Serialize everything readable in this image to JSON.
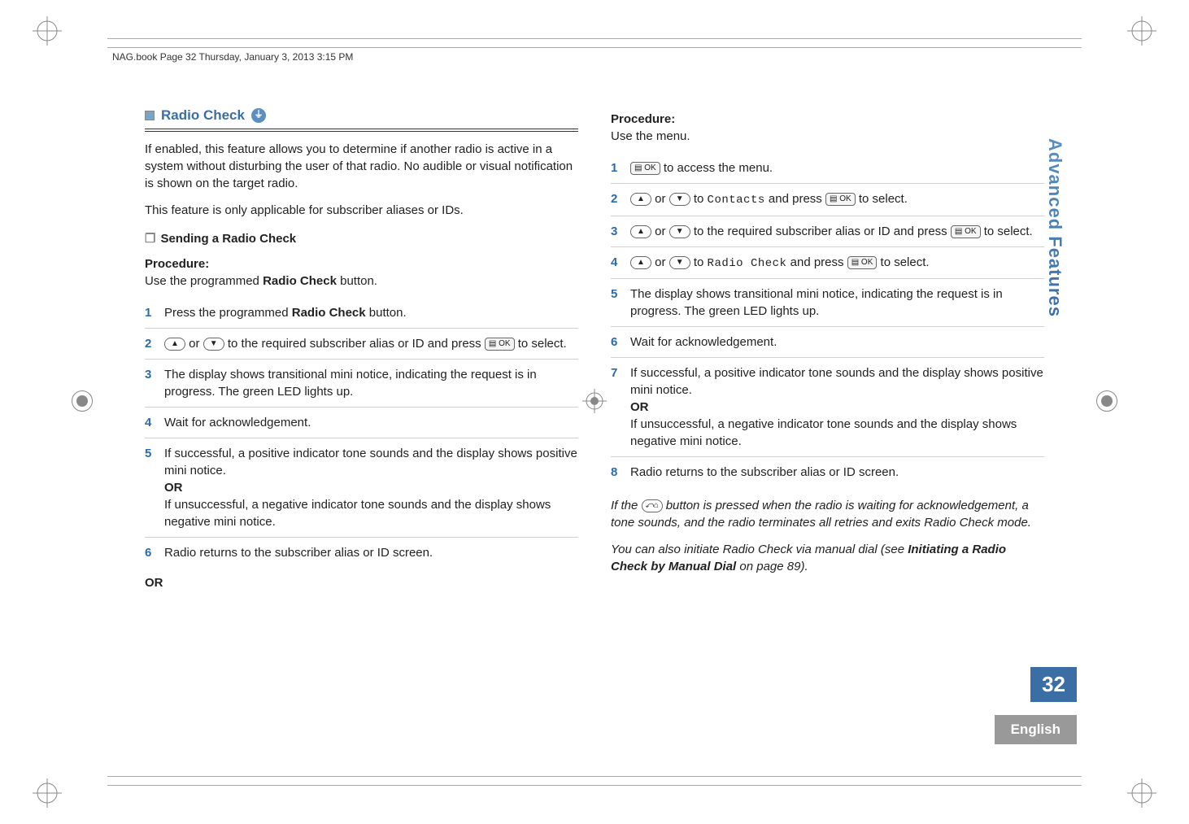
{
  "header": "NAG.book  Page 32  Thursday, January 3, 2013  3:15 PM",
  "side_tab": "Advanced Features",
  "page_number": "32",
  "language": "English",
  "left": {
    "section_title": "Radio Check",
    "para1": "If enabled, this feature allows you to determine if another radio is active in a system without disturbing the user of that radio. No audible or visual notification is shown on the target radio.",
    "para2": "This feature is only applicable for subscriber aliases or IDs.",
    "sub_title": "Sending a Radio Check",
    "proc_label": "Procedure:",
    "proc_sub": "Use the programmed Radio Check button.",
    "steps": [
      "Press the programmed Radio Check button.",
      "__UPDOWN__ to the required subscriber alias or ID and press __OK__ to select.",
      "The display shows transitional mini notice, indicating the request is in progress. The green LED lights up.",
      "Wait for acknowledgement.",
      "If successful, a positive indicator tone sounds and the display shows positive mini notice.\nOR\nIf unsuccessful, a negative indicator tone sounds and the display shows negative mini notice.",
      "Radio returns to the subscriber alias or ID screen."
    ],
    "or_end": "OR"
  },
  "right": {
    "proc_label": "Procedure:",
    "proc_sub": "Use the menu.",
    "steps": {
      "s1": " to access the menu.",
      "s2a": " or ",
      "s2b": " to ",
      "s2_contacts": "Contacts",
      "s2c": " and press ",
      "s2d": " to select.",
      "s3a": " or ",
      "s3b": " to the required subscriber alias or ID and press ",
      "s3c": " to select.",
      "s4a": " or ",
      "s4b": " to ",
      "s4_radio": "Radio Check",
      "s4c": " and press ",
      "s4d": " to select.",
      "s5": "The display shows transitional mini notice, indicating the request is in progress. The green LED lights up.",
      "s6": "Wait for acknowledgement.",
      "s7a": "If successful, a positive indicator tone sounds and the display shows positive mini notice.",
      "s7or": "OR",
      "s7b": "If unsuccessful, a negative indicator tone sounds and the display shows negative mini notice.",
      "s8": "Radio returns to the subscriber alias or ID screen."
    },
    "note1a": "If the ",
    "note1b": " button is pressed when the radio is waiting for acknowledgement, a tone sounds, and the radio terminates all retries and exits Radio Check mode.",
    "note2a": "You can also initiate Radio Check via manual dial (see ",
    "note2ref": "Initiating a Radio Check by Manual Dial",
    "note2b": " on page 89)."
  }
}
